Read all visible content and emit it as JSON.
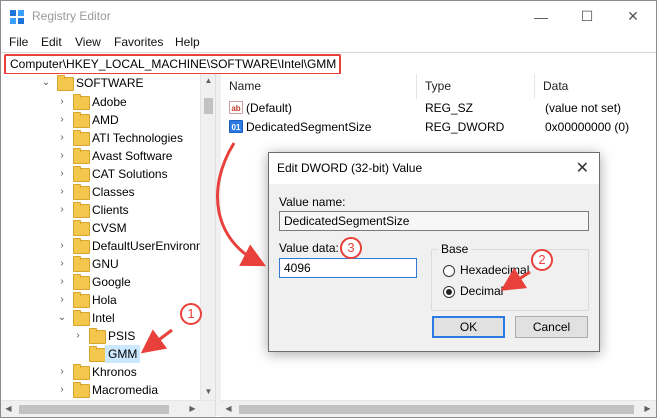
{
  "window": {
    "title": "Registry Editor",
    "minimize_glyph": "—",
    "maximize_glyph": "☐",
    "close_glyph": "✕"
  },
  "menu": [
    "File",
    "Edit",
    "View",
    "Favorites",
    "Help"
  ],
  "address": "Computer\\HKEY_LOCAL_MACHINE\\SOFTWARE\\Intel\\GMM",
  "tree": {
    "items": [
      {
        "label": "SOFTWARE"
      },
      {
        "label": "Adobe"
      },
      {
        "label": "AMD"
      },
      {
        "label": "ATI Technologies"
      },
      {
        "label": "Avast Software"
      },
      {
        "label": "CAT Solutions"
      },
      {
        "label": "Classes"
      },
      {
        "label": "Clients"
      },
      {
        "label": "CVSM"
      },
      {
        "label": "DefaultUserEnvironn"
      },
      {
        "label": "GNU"
      },
      {
        "label": "Google"
      },
      {
        "label": "Hola"
      },
      {
        "label": "Intel"
      },
      {
        "label": "PSIS"
      },
      {
        "label": "GMM"
      },
      {
        "label": "Khronos"
      },
      {
        "label": "Macromedia"
      }
    ]
  },
  "list": {
    "columns": [
      "Name",
      "Type",
      "Data"
    ],
    "rows": [
      {
        "icon": "string-value-icon",
        "name": "(Default)",
        "type": "REG_SZ",
        "data": "(value not set)"
      },
      {
        "icon": "dword-value-icon",
        "name": "DedicatedSegmentSize",
        "type": "REG_DWORD",
        "data": "0x00000000 (0)"
      }
    ]
  },
  "dialog": {
    "title": "Edit DWORD (32-bit) Value",
    "value_name_label": "Value name:",
    "value_name": "DedicatedSegmentSize",
    "value_data_label": "Value data:",
    "value_data": "4096",
    "base_label": "Base",
    "radio_hex": "Hexadecimal",
    "radio_dec": "Decimal",
    "selected_base": "Decimal",
    "ok": "OK",
    "cancel": "Cancel"
  },
  "callouts": [
    "1",
    "2",
    "3"
  ],
  "colors": {
    "accent_red": "#e8413b",
    "selection": "#cce8ff",
    "focus_blue": "#2c7be5",
    "folder": "#f3c74c"
  }
}
